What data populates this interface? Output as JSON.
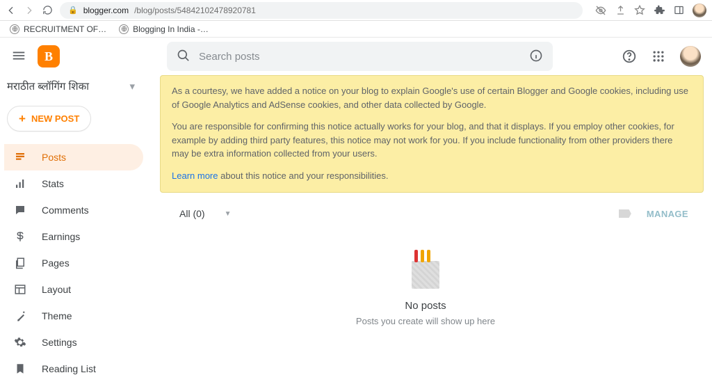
{
  "browser": {
    "url_host": "blogger.com",
    "url_path": "/blog/posts/54842102478920781",
    "bookmarks": [
      "RECRUITMENT OF…",
      "Blogging In India -…"
    ]
  },
  "search": {
    "placeholder": "Search posts"
  },
  "blogSelector": {
    "name": "मराठीत ब्लॉगिंग शिका"
  },
  "newPost": {
    "label": "NEW POST"
  },
  "sidebar": {
    "items": [
      {
        "label": "Posts"
      },
      {
        "label": "Stats"
      },
      {
        "label": "Comments"
      },
      {
        "label": "Earnings"
      },
      {
        "label": "Pages"
      },
      {
        "label": "Layout"
      },
      {
        "label": "Theme"
      },
      {
        "label": "Settings"
      },
      {
        "label": "Reading List"
      }
    ]
  },
  "notice": {
    "p1": "As a courtesy, we have added a notice on your blog to explain Google's use of certain Blogger and Google cookies, including use of Google Analytics and AdSense cookies, and other data collected by Google.",
    "p2": "You are responsible for confirming this notice actually works for your blog, and that it displays. If you employ other cookies, for example by adding third party features, this notice may not work for you. If you include functionality from other providers there may be extra information collected from your users.",
    "learnMore": "Learn more",
    "after": " about this notice and your responsibilities."
  },
  "filter": {
    "label": "All (0)"
  },
  "manage": {
    "label": "MANAGE"
  },
  "empty": {
    "title": "No posts",
    "sub": "Posts you create will show up here"
  }
}
